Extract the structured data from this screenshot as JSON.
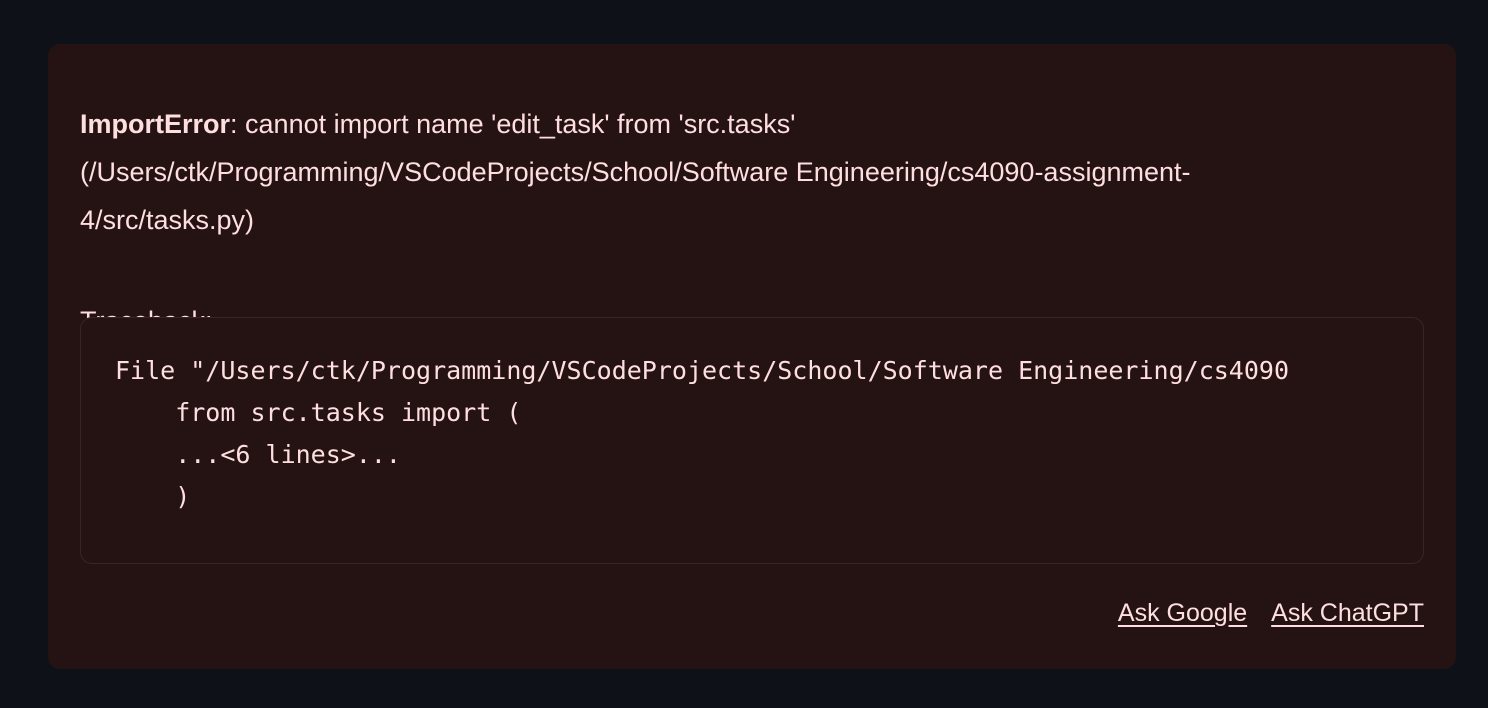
{
  "error": {
    "type": "ImportError",
    "message": ": cannot import name 'edit_task' from 'src.tasks' (/Users/ctk/Programming/VSCodeProjects/School/Software Engineering/cs4090-assignment-4/src/tasks.py)"
  },
  "traceback": {
    "label": "Traceback:",
    "lines": [
      "File \"/Users/ctk/Programming/VSCodeProjects/School/Software Engineering/cs4090",
      "    from src.tasks import (",
      "    ...<6 lines>...",
      "    )"
    ]
  },
  "links": {
    "google": "Ask Google",
    "chatgpt": "Ask ChatGPT"
  }
}
